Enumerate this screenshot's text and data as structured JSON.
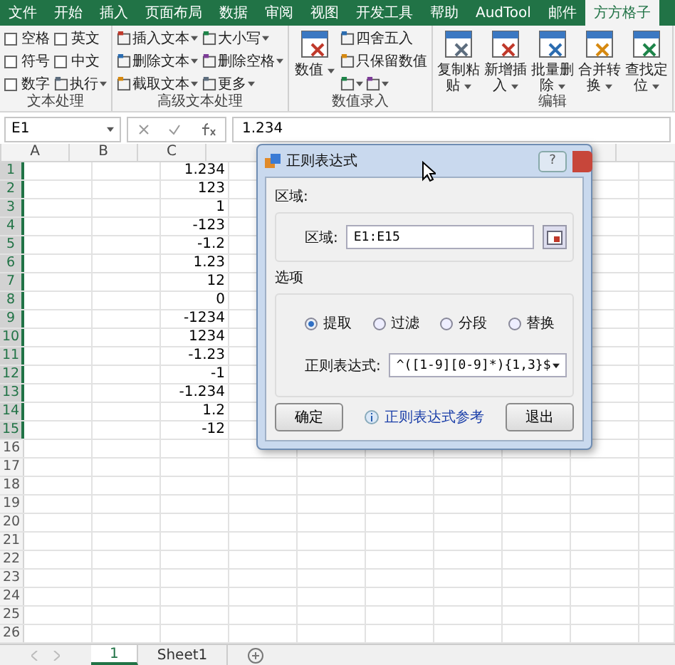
{
  "ribbon_tabs": [
    {
      "label": "文件",
      "selected": false
    },
    {
      "label": "开始",
      "selected": false
    },
    {
      "label": "插入",
      "selected": false
    },
    {
      "label": "页面布局",
      "selected": false
    },
    {
      "label": "数据",
      "selected": false
    },
    {
      "label": "审阅",
      "selected": false
    },
    {
      "label": "视图",
      "selected": false
    },
    {
      "label": "开发工具",
      "selected": false
    },
    {
      "label": "帮助",
      "selected": false
    },
    {
      "label": "AudTool",
      "selected": false
    },
    {
      "label": "邮件",
      "selected": false
    },
    {
      "label": "方方格子",
      "selected": true
    }
  ],
  "ribbon_groups": [
    {
      "label": "文本处理",
      "columns": [
        {
          "kind": "stack",
          "rows": [
            [
              {
                "kind": "checkbox",
                "label": "空格",
                "checked": false
              }
            ],
            [
              {
                "kind": "checkbox",
                "label": "符号",
                "checked": false
              }
            ],
            [
              {
                "kind": "checkbox",
                "label": "数字",
                "checked": false
              }
            ]
          ]
        },
        {
          "kind": "stack",
          "rows": [
            [
              {
                "kind": "checkbox",
                "label": "英文",
                "checked": false
              }
            ],
            [
              {
                "kind": "checkbox",
                "label": "中文",
                "checked": false
              }
            ],
            [
              {
                "kind": "menu",
                "label": "执行",
                "dropdown": true
              }
            ]
          ]
        }
      ]
    },
    {
      "label": "高级文本处理",
      "columns": [
        {
          "kind": "stack",
          "rows": [
            [
              {
                "kind": "menu",
                "label": "插入文本",
                "dropdown": true
              }
            ],
            [
              {
                "kind": "menu",
                "label": "删除文本",
                "dropdown": true
              }
            ],
            [
              {
                "kind": "menu",
                "label": "截取文本",
                "dropdown": true
              }
            ]
          ]
        },
        {
          "kind": "stack",
          "rows": [
            [
              {
                "kind": "menu",
                "label": "大小写",
                "dropdown": true
              }
            ],
            [
              {
                "kind": "menu",
                "label": "删除空格",
                "dropdown": true
              }
            ],
            [
              {
                "kind": "menu",
                "label": "更多",
                "dropdown": true
              }
            ]
          ]
        }
      ]
    },
    {
      "label": "数值录入",
      "columns": [
        {
          "kind": "large",
          "label": "数值",
          "dropdown": true
        },
        {
          "kind": "stack",
          "rows": [
            [
              {
                "kind": "menu",
                "label": "四舍五入",
                "dropdown": false
              }
            ],
            [
              {
                "kind": "menu",
                "label": "只保留数值",
                "dropdown": false
              }
            ],
            [
              {
                "kind": "icon-menu",
                "dropdown": true
              },
              {
                "kind": "icon-menu",
                "dropdown": true
              }
            ]
          ]
        }
      ]
    },
    {
      "label": "编辑",
      "columns": [
        {
          "kind": "large",
          "label": "复制粘贴",
          "dropdown": true
        },
        {
          "kind": "large",
          "label": "新增插入",
          "dropdown": true
        },
        {
          "kind": "large",
          "label": "批量删除",
          "dropdown": true
        },
        {
          "kind": "large",
          "label": "合并转换",
          "dropdown": true
        },
        {
          "kind": "large",
          "label": "查找定位",
          "dropdown": true
        }
      ]
    }
  ],
  "formula_bar": {
    "name_box": "E1",
    "value": "1.234"
  },
  "sheet": {
    "columns": [
      "A",
      "B",
      "C"
    ],
    "rows": [
      {
        "number": "1",
        "selected": true,
        "c": "1.234"
      },
      {
        "number": "2",
        "selected": true,
        "c": "123"
      },
      {
        "number": "3",
        "selected": true,
        "c": "1"
      },
      {
        "number": "4",
        "selected": true,
        "c": "-123"
      },
      {
        "number": "5",
        "selected": true,
        "c": "-1.2"
      },
      {
        "number": "6",
        "selected": true,
        "c": "1.23"
      },
      {
        "number": "7",
        "selected": true,
        "c": "12"
      },
      {
        "number": "8",
        "selected": true,
        "c": "0"
      },
      {
        "number": "9",
        "selected": true,
        "c": "-1234"
      },
      {
        "number": "10",
        "selected": true,
        "c": "1234"
      },
      {
        "number": "11",
        "selected": true,
        "c": "-1.23"
      },
      {
        "number": "12",
        "selected": true,
        "c": "-1"
      },
      {
        "number": "13",
        "selected": true,
        "c": "-1.234"
      },
      {
        "number": "14",
        "selected": true,
        "c": "1.2"
      },
      {
        "number": "15",
        "selected": true,
        "c": "-12"
      },
      {
        "number": "16",
        "selected": false
      },
      {
        "number": "17",
        "selected": false
      },
      {
        "number": "18",
        "selected": false
      },
      {
        "number": "19",
        "selected": false
      },
      {
        "number": "20",
        "selected": false
      },
      {
        "number": "21",
        "selected": false
      },
      {
        "number": "22",
        "selected": false
      },
      {
        "number": "23",
        "selected": false
      },
      {
        "number": "24",
        "selected": false
      },
      {
        "number": "25",
        "selected": false
      },
      {
        "number": "26",
        "selected": false
      }
    ]
  },
  "sheet_tabs": [
    {
      "label": "1",
      "selected": true
    },
    {
      "label": "Sheet1",
      "selected": false
    }
  ],
  "dialog": {
    "title": "正则表达式",
    "help": "?",
    "range_group": {
      "title": "区域:",
      "label": "区域:",
      "value": "E1:E15"
    },
    "options_group": {
      "title": "选项",
      "radios": [
        {
          "label": "提取",
          "selected": true
        },
        {
          "label": "过滤",
          "selected": false
        },
        {
          "label": "分段",
          "selected": false
        },
        {
          "label": "替换",
          "selected": false
        }
      ],
      "regex_label": "正则表达式:",
      "regex_value": "^([1-9][0-9]*){1,3}$"
    },
    "ok": "确定",
    "link": "正则表达式参考",
    "exit": "退出"
  }
}
